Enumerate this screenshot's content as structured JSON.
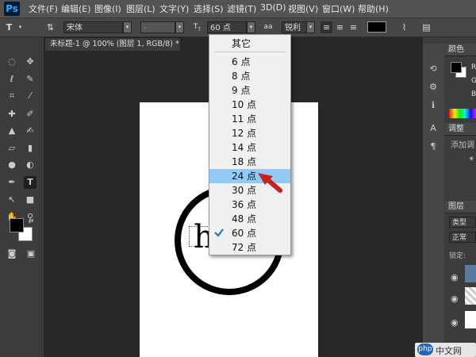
{
  "app": {
    "logo": "Ps"
  },
  "menubar": {
    "items": [
      "文件(F)",
      "编辑(E)",
      "图像(I)",
      "图层(L)",
      "文字(Y)",
      "选择(S)",
      "滤镜(T)",
      "3D(D)",
      "视图(V)",
      "窗口(W)",
      "帮助(H)"
    ]
  },
  "options": {
    "font_family": "宋体",
    "font_style": "-",
    "font_size": "60 点",
    "aa_icon": "aa",
    "antialias": "锐利",
    "color": "#000000"
  },
  "document_tab": {
    "title": "未标题-1 @ 100% (图层 1, RGB/8) *",
    "close": "×"
  },
  "canvas": {
    "text": "h"
  },
  "dropdown": {
    "header": "其它",
    "items": [
      "6 点",
      "8 点",
      "9 点",
      "10 点",
      "11 点",
      "12 点",
      "14 点",
      "18 点",
      "24 点",
      "30 点",
      "36 点",
      "48 点",
      "60 点",
      "72 点"
    ],
    "highlighted": "24 点",
    "checked": "60 点"
  },
  "right_panel": {
    "color_title": "颜色",
    "adjust_title": "调整",
    "adjust_sub": "添加调",
    "layers_title": "图层",
    "layers_search": "类型",
    "blend": "正常",
    "lock": "锁定:",
    "color_labels": [
      "R",
      "G",
      "B"
    ]
  },
  "watermark": {
    "text": "php 中文网"
  },
  "colors": {
    "highlight": "#91c9f7",
    "arrow": "#cc1f1f"
  }
}
